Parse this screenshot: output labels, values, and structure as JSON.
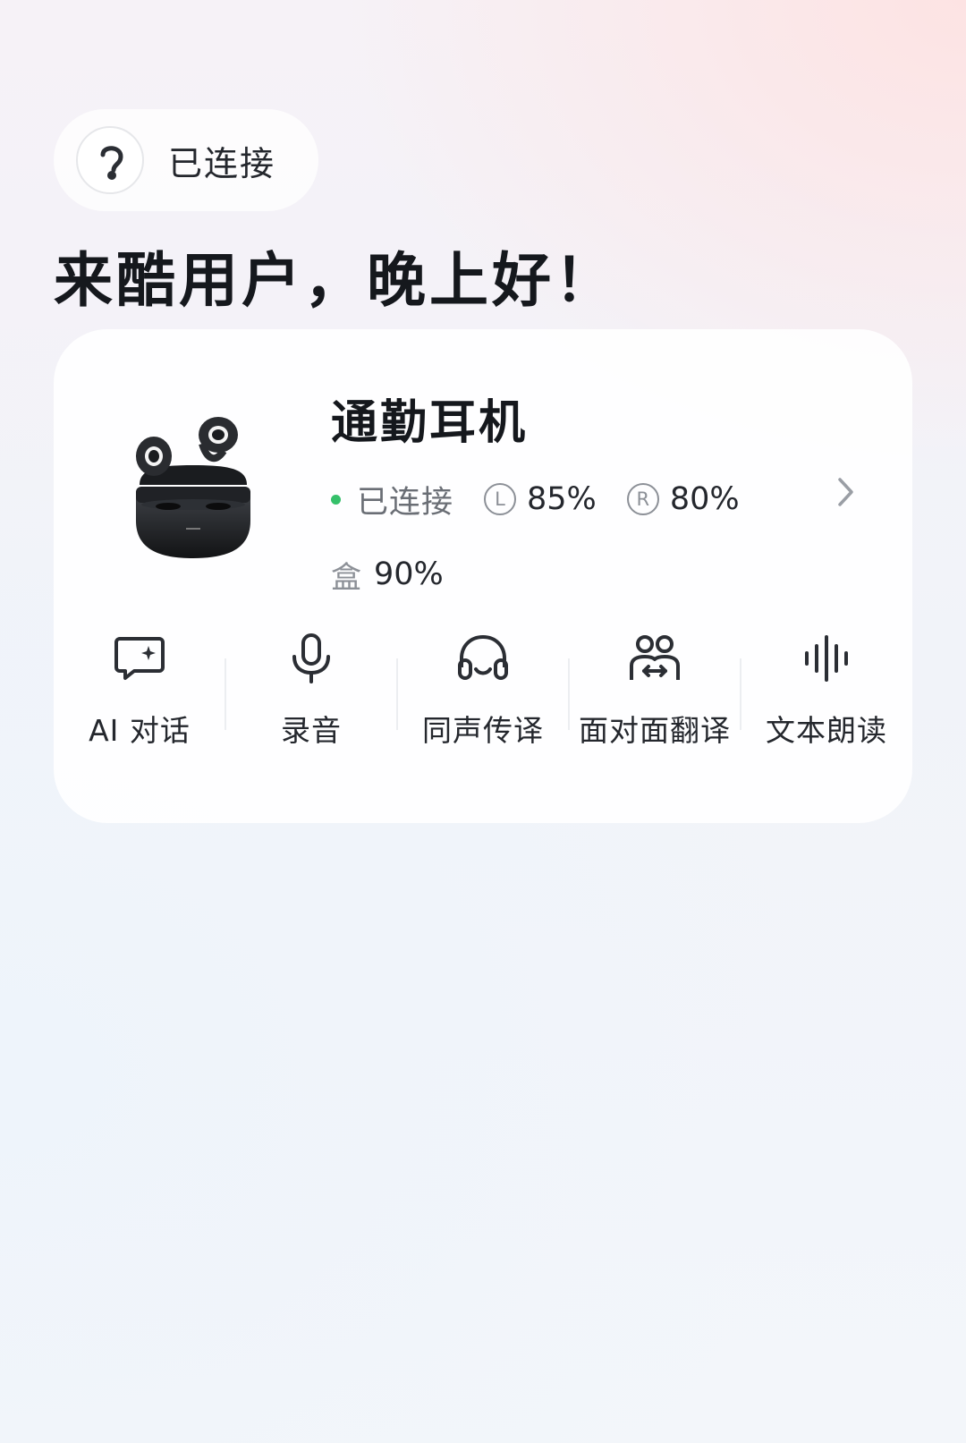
{
  "status_pill": {
    "icon": "earphone-icon",
    "label": "已连接"
  },
  "greeting": "来酷用户，晚上好！",
  "device_card": {
    "name": "通勤耳机",
    "connection_status": "已连接",
    "connection_color": "#35c06a",
    "left_badge": "L",
    "left_battery": "85%",
    "right_badge": "R",
    "right_battery": "80%",
    "case_label": "盒",
    "case_battery": "90%",
    "image_icon": "earbuds-case-image"
  },
  "features": [
    {
      "label": "AI 对话",
      "icon": "chat-sparkle-icon"
    },
    {
      "label": "录音",
      "icon": "microphone-icon"
    },
    {
      "label": "同声传译",
      "icon": "headphones-icon"
    },
    {
      "label": "面对面翻译",
      "icon": "two-people-icon"
    },
    {
      "label": "文本朗读",
      "icon": "sound-wave-icon"
    }
  ]
}
